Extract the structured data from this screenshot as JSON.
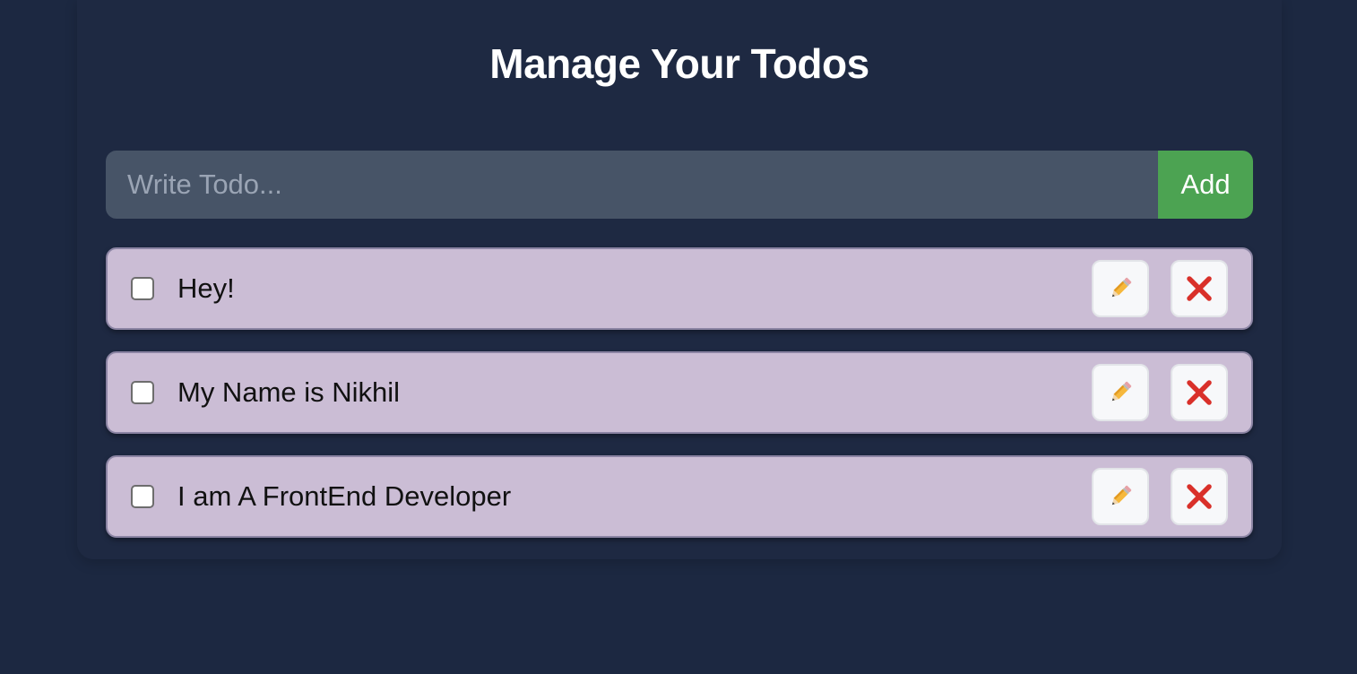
{
  "header": {
    "title": "Manage Your Todos"
  },
  "input": {
    "placeholder": "Write Todo...",
    "value": "",
    "add_label": "Add"
  },
  "todos": [
    {
      "text": "Hey!",
      "completed": false
    },
    {
      "text": "My Name is Nikhil",
      "completed": false
    },
    {
      "text": "I am A FrontEnd Developer",
      "completed": false
    }
  ],
  "icons": {
    "edit": "pencil-icon",
    "delete": "cross-icon"
  },
  "colors": {
    "background": "#1c2841",
    "input_bg": "#475467",
    "add_button": "#4ca352",
    "todo_bg": "#cbbdd5",
    "delete_red": "#d9302a"
  }
}
